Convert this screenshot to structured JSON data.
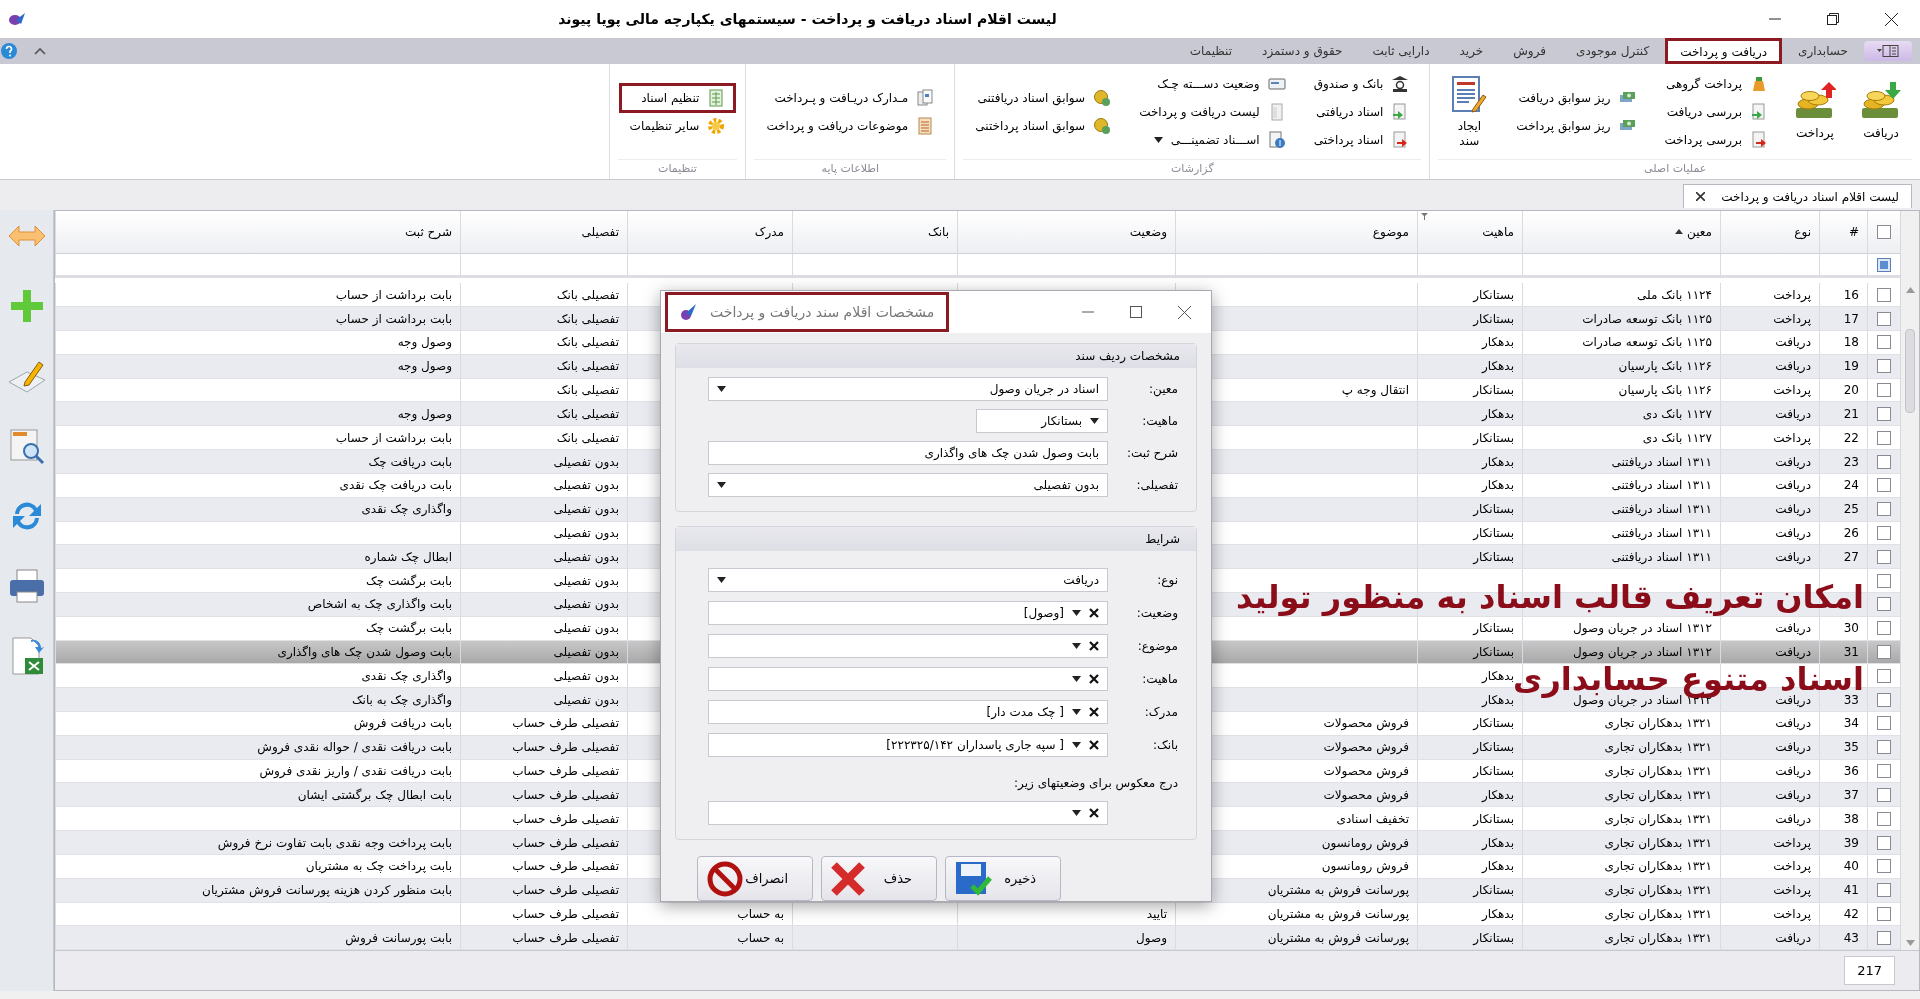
{
  "window": {
    "title": "لیست اقلام اسناد دریافت و پرداخت - سیستمهای یکپارچه مالی پویا پیوند"
  },
  "tabs": [
    {
      "label": "حسابداری",
      "selected": false,
      "outlined": false
    },
    {
      "label": "دریافت و پرداخت",
      "selected": true,
      "outlined": true
    },
    {
      "label": "کنترل موجودی",
      "selected": false,
      "outlined": false
    },
    {
      "label": "فروش",
      "selected": false,
      "outlined": false
    },
    {
      "label": "خرید",
      "selected": false,
      "outlined": false
    },
    {
      "label": "دارایی ثابت",
      "selected": false,
      "outlined": false
    },
    {
      "label": "حقوق و دستمزد",
      "selected": false,
      "outlined": false
    },
    {
      "label": "تنظیمات",
      "selected": false,
      "outlined": false
    }
  ],
  "ribbon": {
    "groups": [
      {
        "label": "عملیات اصلی",
        "columns": [
          [
            {
              "label": "دریافت",
              "kind": "large",
              "outlined": false
            }
          ],
          [
            {
              "label": "پرداخت",
              "kind": "large",
              "outlined": false
            }
          ],
          [
            {
              "label": "پرداخت گروهی",
              "kind": "small",
              "outlined": false
            },
            {
              "label": "بررسی دریافت",
              "kind": "small",
              "outlined": false
            },
            {
              "label": "بررسی پرداخت",
              "kind": "small",
              "outlined": false
            }
          ],
          [
            {
              "label": "ریز سوابق دریافت",
              "kind": "small",
              "outlined": false
            },
            {
              "label": "ریز سوابق پرداخت",
              "kind": "small",
              "outlined": false
            }
          ],
          [
            {
              "label": "ایجاد سند",
              "kind": "large",
              "outlined": false
            }
          ]
        ]
      },
      {
        "label": "گزارشات",
        "columns": [
          [
            {
              "label": "بانک و صندوق",
              "kind": "small",
              "outlined": false
            },
            {
              "label": "اسناد دریافتی",
              "kind": "small",
              "outlined": false
            },
            {
              "label": "اسناد پرداختی",
              "kind": "small",
              "outlined": false
            }
          ],
          [
            {
              "label": "وضعیت دســـته چـک",
              "kind": "small",
              "outlined": false
            },
            {
              "label": "لیست دریافت و پرداخت",
              "kind": "small",
              "outlined": false
            },
            {
              "label": "اســـناد تضمینـــی",
              "kind": "dropdown",
              "outlined": false
            }
          ],
          [
            {
              "label": "سوابق اسناد دریافتنی",
              "kind": "small",
              "outlined": false
            },
            {
              "label": "سوابق اسناد پرداختنی",
              "kind": "small",
              "outlined": false
            }
          ]
        ]
      },
      {
        "label": "اطلاعات پایه",
        "columns": [
          [
            {
              "label": "مـدارک دریـافت و پـرداخت",
              "kind": "small",
              "outlined": false
            },
            {
              "label": "موضوعات دریافت و پرداخت",
              "kind": "small",
              "outlined": false
            }
          ]
        ]
      },
      {
        "label": "تنظیمات",
        "columns": [
          [
            {
              "label": "تنظیم اسناد",
              "kind": "small",
              "outlined": true
            },
            {
              "label": "سایر تنظیمات",
              "kind": "small",
              "outlined": false
            }
          ]
        ]
      }
    ]
  },
  "doc_tab": {
    "label": "لیست اقلام اسناد دریافت و پرداخت"
  },
  "table": {
    "select_all": {
      "checked": false
    },
    "columns": [
      {
        "label": "#"
      },
      {
        "label": "نوع"
      },
      {
        "label": "معین",
        "sorted": true
      },
      {
        "label": "ماهیت",
        "filter": true
      },
      {
        "label": "موضوع"
      },
      {
        "label": "وضعیت"
      },
      {
        "label": "بانک"
      },
      {
        "label": "مدرک"
      },
      {
        "label": "تفصیلی"
      },
      {
        "label": "شرح ثبت"
      }
    ],
    "rows": [
      {
        "number": "16",
        "type": "پرداخت",
        "account": "۱۱۲۴ بانک ملی",
        "nature": "بستانکار",
        "detail": "تفصیلی بانک",
        "description": "بابت برداشت از حساب",
        "checked": false,
        "selected": false
      },
      {
        "number": "17",
        "type": "پرداخت",
        "account": "۱۱۲۵ بانک توسعه صادرات",
        "nature": "بستانکار",
        "detail": "تفصیلی بانک",
        "description": "بابت برداشت از حساب",
        "checked": false,
        "selected": false
      },
      {
        "number": "18",
        "type": "دریافت",
        "account": "۱۱۲۵ بانک توسعه صادرات",
        "nature": "بدهکار",
        "detail": "تفصیلی بانک",
        "description": "وصول وجه",
        "checked": false,
        "selected": false
      },
      {
        "number": "19",
        "type": "دریافت",
        "account": "۱۱۲۶ بانک پارسیان",
        "nature": "بدهکار",
        "detail": "تفصیلی بانک",
        "description": "وصول وجه",
        "checked": false,
        "selected": false
      },
      {
        "number": "20",
        "type": "پرداخت",
        "account": "۱۱۲۶ بانک پارسیان",
        "nature": "بستانکار",
        "subject": "انتقال وجه پ",
        "detail": "تفصیلی بانک",
        "checked": false,
        "selected": false
      },
      {
        "number": "21",
        "type": "دریافت",
        "account": "۱۱۲۷ بانک دی",
        "nature": "بدهکار",
        "detail": "تفصیلی بانک",
        "description": "وصول وجه",
        "checked": false,
        "selected": false
      },
      {
        "number": "22",
        "type": "پرداخت",
        "account": "۱۱۲۷ بانک دی",
        "nature": "بستانکار",
        "detail": "تفصیلی بانک",
        "description": "بابت برداشت از حساب",
        "checked": false,
        "selected": false
      },
      {
        "number": "23",
        "type": "دریافت",
        "account": "۱۳۱۱ اسناد دریافتنی",
        "nature": "بدهکار",
        "detail": "بدون تفصیلی",
        "description": "بابت دریافت چک",
        "checked": false,
        "selected": false
      },
      {
        "number": "24",
        "type": "دریافت",
        "account": "۱۳۱۱ اسناد دریافتنی",
        "nature": "بدهکار",
        "detail": "بدون تفصیلی",
        "description": "بابت دریافت چک نقدی",
        "checked": false,
        "selected": false
      },
      {
        "number": "25",
        "type": "دریافت",
        "account": "۱۳۱۱ اسناد دریافتنی",
        "nature": "بستانکار",
        "detail": "بدون تفصیلی",
        "description": "واگذاری چک نقدی",
        "checked": false,
        "selected": false
      },
      {
        "number": "26",
        "type": "دریافت",
        "account": "۱۳۱۱ اسناد دریافتنی",
        "nature": "بستانکار",
        "detail": "بدون تفصیلی",
        "checked": false,
        "selected": false
      },
      {
        "number": "27",
        "type": "دریافت",
        "account": "۱۳۱۱ اسناد دریافتنی",
        "nature": "بستانکار",
        "detail": "بدون تفصیلی",
        "description": "ابطال چک شماره",
        "checked": false,
        "selected": false
      },
      {
        "detail": "بدون تفصیلی",
        "description": "بابت برگشت چک",
        "checked": false,
        "selected": false
      },
      {
        "detail": "بدون تفصیلی",
        "description": "بابت واگذاری چک به اشخاص",
        "checked": false,
        "selected": false
      },
      {
        "number": "30",
        "type": "دریافت",
        "account": "۱۳۱۲ اسناد در جریان وصول",
        "nature": "بستانکار",
        "detail": "بدون تفصیلی",
        "description": "بابت برگشت چک",
        "checked": false,
        "selected": false
      },
      {
        "number": "31",
        "type": "دریافت",
        "account": "۱۳۱۲ اسناد در جریان وصول",
        "nature": "بستانکار",
        "detail": "بدون تفصیلی",
        "description": "بابت وصول شدن چک های واگذاری",
        "checked": false,
        "selected": true
      },
      {
        "nature": "بدهکار",
        "detail": "بدون تفصیلی",
        "description": "واگذاری چک نقدی",
        "checked": false,
        "selected": false
      },
      {
        "number": "33",
        "type": "دریافت",
        "account": "۱۳۱۲ اسناد در جریان وصول",
        "nature": "بدهکار",
        "detail": "بدون تفصیلی",
        "description": "واگذاری چک به بانک",
        "checked": false,
        "selected": false
      },
      {
        "number": "34",
        "type": "دریافت",
        "account": "۱۳۲۱ بدهکاران تجاری",
        "nature": "بستانکار",
        "subject": "فروش محصولات",
        "detail": "تفصیلی طرف حساب",
        "description": "بابت دریافت فروش",
        "checked": false,
        "selected": false
      },
      {
        "number": "35",
        "type": "دریافت",
        "account": "۱۳۲۱ بدهکاران تجاری",
        "nature": "بستانکار",
        "subject": "فروش محصولات",
        "detail": "تفصیلی طرف حساب",
        "description": "بابت دریافت نقدی / حواله نقدی فروش",
        "checked": false,
        "selected": false
      },
      {
        "number": "36",
        "type": "دریافت",
        "account": "۱۳۲۱ بدهکاران تجاری",
        "nature": "بستانکار",
        "subject": "فروش محصولات",
        "detail": "تفصیلی طرف حساب",
        "description": "بابت دریافت نقدی / واریز نقدی فروش",
        "checked": false,
        "selected": false
      },
      {
        "number": "37",
        "type": "دریافت",
        "account": "۱۳۲۱ بدهکاران تجاری",
        "nature": "بدهکار",
        "subject": "فروش محصولات",
        "detail": "تفصیلی طرف حساب",
        "description": "بابت ابطال چک برگشتی ایشان",
        "checked": false,
        "selected": false
      },
      {
        "number": "38",
        "type": "دریافت",
        "account": "۱۳۲۱ بدهکاران تجاری",
        "nature": "بستانکار",
        "subject": "تخفیف اسنادی",
        "detail": "تفصیلی طرف حساب",
        "checked": false,
        "selected": false
      },
      {
        "number": "39",
        "type": "پرداخت",
        "account": "۱۳۲۱ بدهکاران تجاری",
        "nature": "بدهکار",
        "subject": "فروش رومانسون",
        "detail": "تفصیلی طرف حساب",
        "description": "بابت پرداخت وجه نقدی بابت تفاوت نرخ فروش",
        "checked": false,
        "selected": false
      },
      {
        "number": "40",
        "type": "پرداخت",
        "account": "۱۳۲۱ بدهکاران تجاری",
        "nature": "بدهکار",
        "subject": "فروش رومانسون",
        "detail": "تفصیلی طرف حساب",
        "description": "بابت پرداخت چک به مشتریان",
        "checked": false,
        "selected": false
      },
      {
        "number": "41",
        "type": "پرداخت",
        "account": "۱۳۲۱ بدهکاران تجاری",
        "nature": "بستانکار",
        "subject": "پورسانت فروش به مشتریان",
        "detail": "تفصیلی طرف حساب",
        "description": "بابت منظور کردن هزینه پورسانت فروش مشتریان",
        "checked": false,
        "selected": false
      },
      {
        "number": "42",
        "type": "پرداخت",
        "account": "۱۳۲۱ بدهکاران تجاری",
        "nature": "بدهکار",
        "subject": "پورسانت فروش به مشتریان",
        "status": "تایید",
        "document": "به حساب",
        "detail": "تفصیلی طرف حساب",
        "checked": false,
        "selected": false
      },
      {
        "number": "43",
        "type": "دریافت",
        "account": "۱۳۲۱ بدهکاران تجاری",
        "nature": "بستانکار",
        "subject": "پورسانت فروش به مشتریان",
        "status": "وصول",
        "document": "به حساب",
        "detail": "تفصیلی طرف حساب",
        "description": "بابت پورسانت فروش",
        "checked": false,
        "selected": false
      }
    ],
    "footer_count": "217"
  },
  "dialog": {
    "title": "مشخصات اقلام سند دریافت و پرداخت",
    "outlined": true,
    "sections": [
      {
        "title": "مشخصات ردیف سند",
        "fields": [
          {
            "label": "معین:",
            "value": "اسناد در جریان وصول",
            "kind": "dropdown"
          },
          {
            "label": "ماهیت:",
            "value": "بستانکار",
            "kind": "short-dropdown"
          },
          {
            "label": "شرح ثبت:",
            "value": "بابت وصول شدن چک های واگذاری",
            "kind": "text"
          },
          {
            "label": "تفصیلی:",
            "value": "بدون تفصیلی",
            "kind": "dropdown"
          }
        ]
      },
      {
        "title": "شرایط",
        "fields": [
          {
            "label": "نوع:",
            "value": "دریافت",
            "kind": "dropdown"
          },
          {
            "label": "وضعیت:",
            "value": "[وصول]",
            "kind": "clearable"
          },
          {
            "label": "موضوع:",
            "kind": "clearable"
          },
          {
            "label": "ماهیت:",
            "kind": "clearable"
          },
          {
            "label": "مدرک:",
            "value": "[ چک مدت دار]",
            "kind": "clearable"
          },
          {
            "label": "بانک:",
            "value": "[ سپه جاری  پاسداران  ۲۲۲۳۲۵/۱۴۲]",
            "kind": "clearable"
          }
        ],
        "note": "درج معکوس برای وضعیتهای زیر:",
        "note_field": {
          "kind": "clearable"
        }
      }
    ],
    "buttons": [
      {
        "label": "ذخیره",
        "kind": "save"
      },
      {
        "label": "حذف",
        "kind": "delete"
      },
      {
        "label": "انصراف",
        "kind": "cancel"
      }
    ]
  },
  "caption": {
    "lines": [
      "امکان تعریف قالب اسناد به منظور تولید",
      "اسناد متنوع حسابداری"
    ]
  }
}
